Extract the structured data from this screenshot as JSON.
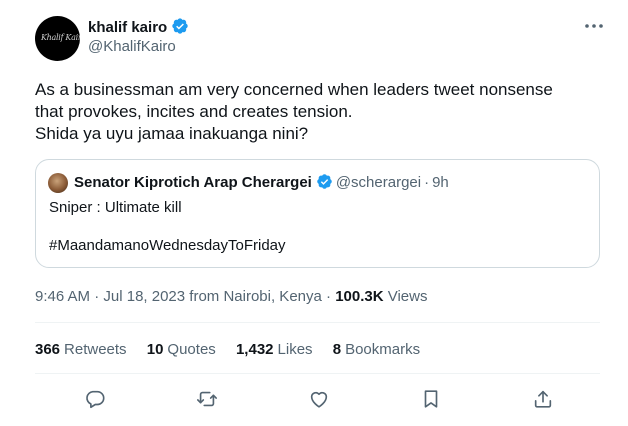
{
  "author": {
    "display_name": "khalif kairo",
    "handle": "@KhalifKairo",
    "avatar_signature": "Khalif Kairo"
  },
  "tweet": {
    "lines": [
      "As a businessman am very concerned when leaders tweet nonsense",
      "that provokes, incites and creates tension.",
      "Shida ya uyu jamaa inakuanga nini?"
    ]
  },
  "quoted_tweet": {
    "display_name": "Senator Kiprotich Arap Cherargei",
    "handle": "@scherargei",
    "separator": "·",
    "age": "9h",
    "line1": "Sniper : Ultimate kill",
    "line2": "#MaandamanoWednesdayToFriday"
  },
  "meta": {
    "time": "9:46 AM",
    "date": "Jul 18, 2023 from Nairobi, Kenya",
    "separator": "·",
    "views_count": "100.3K",
    "views_label": "Views"
  },
  "stats": {
    "retweets_count": "366",
    "retweets_label": "Retweets",
    "quotes_count": "10",
    "quotes_label": "Quotes",
    "likes_count": "1,432",
    "likes_label": "Likes",
    "bookmarks_count": "8",
    "bookmarks_label": "Bookmarks"
  },
  "icons": {
    "verified": "verified-badge-icon",
    "more": "more-options-icon",
    "reply": "reply-icon",
    "retweet": "retweet-icon",
    "like": "like-icon",
    "bookmark": "bookmark-icon",
    "share": "share-icon"
  },
  "colors": {
    "verified_blue": "#1d9bf0",
    "secondary_text": "#536471",
    "primary_text": "#0f1419",
    "border": "#cfd9de"
  }
}
